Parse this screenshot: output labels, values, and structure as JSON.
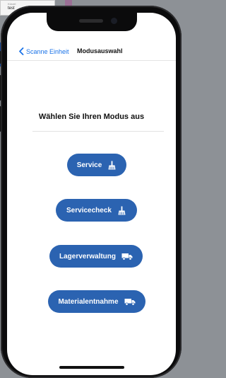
{
  "background": {
    "field_label": "Kürzel",
    "field_value": "test"
  },
  "navbar": {
    "back_label": "Scanne Einheit",
    "title": "Modusauswahl"
  },
  "heading": "Wählen Sie Ihren Modus aus",
  "modes": [
    {
      "label": "Service",
      "icon": "broom-icon"
    },
    {
      "label": "Servicecheck",
      "icon": "broom-icon"
    },
    {
      "label": "Lagerverwaltung",
      "icon": "truck-icon"
    },
    {
      "label": "Materialentnahme",
      "icon": "truck-icon"
    }
  ],
  "colors": {
    "accent": "#1a73e8",
    "button": "#2b63b1",
    "text": "#111111"
  }
}
